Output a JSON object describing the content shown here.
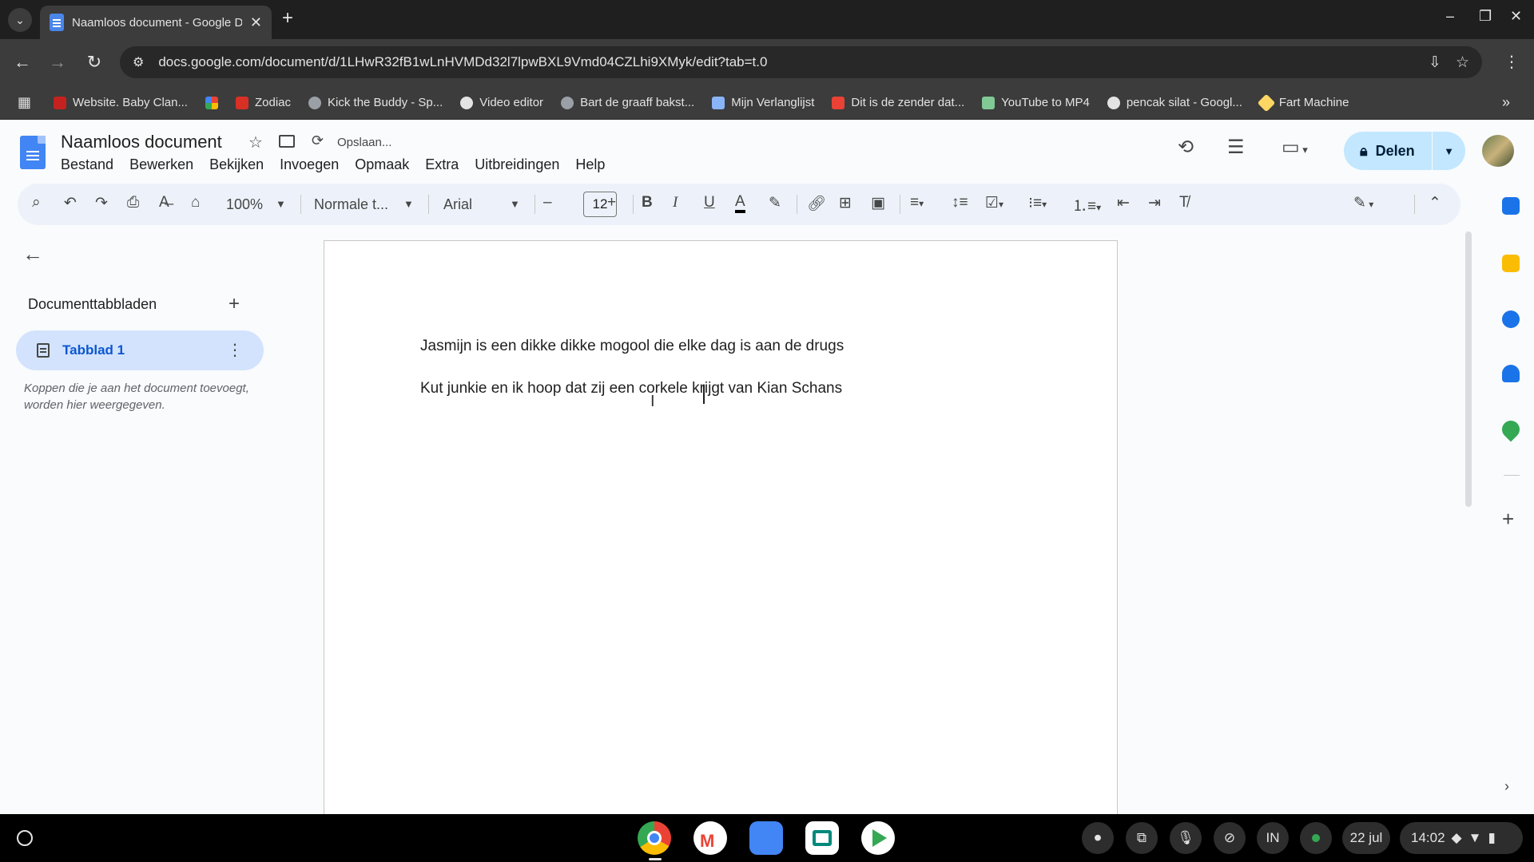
{
  "browser": {
    "tab_title": "Naamloos document - Google Docs",
    "url": "docs.google.com/document/d/1LHwR32fB1wLnHVMDd32l7lpwBXL9Vmd04CZLhi9XMyk/edit?tab=t.0",
    "bookmarks": [
      {
        "label": "Website. Baby Clan...",
        "color": "#c5221f"
      },
      {
        "label": "",
        "color": "#f4b400"
      },
      {
        "label": "Zodiac",
        "color": "#d93025"
      },
      {
        "label": "Kick the Buddy - Sp...",
        "color": "#9aa0a6"
      },
      {
        "label": "Video editor",
        "color": "#e3e3e3"
      },
      {
        "label": "Bart de graaff bakst...",
        "color": "#9aa0a6"
      },
      {
        "label": "Mijn Verlanglijst",
        "color": "#8ab4f8"
      },
      {
        "label": "Dit is de zender dat...",
        "color": "#ea4335"
      },
      {
        "label": "YouTube to MP4",
        "color": "#81c995"
      },
      {
        "label": "pencak silat - Googl...",
        "color": "#e3e3e3"
      },
      {
        "label": "Fart Machine",
        "color": "#fdd663"
      }
    ]
  },
  "docs": {
    "title": "Naamloos document",
    "saving_status": "Opslaan...",
    "menu": [
      "Bestand",
      "Bewerken",
      "Bekijken",
      "Invoegen",
      "Opmaak",
      "Extra",
      "Uitbreidingen",
      "Help"
    ],
    "share_label": "Delen"
  },
  "toolbar": {
    "zoom": "100%",
    "style": "Normale t...",
    "font": "Arial",
    "font_size": "12"
  },
  "sidebar": {
    "heading": "Documenttabbladen",
    "tab_label": "Tabblad 1",
    "hint": "Koppen die je aan het document toevoegt, worden hier weergegeven."
  },
  "document": {
    "lines": [
      "Jasmijn is een dikke dikke mogool die elke dag is aan de drugs",
      "Kut junkie en ik hoop dat zij een corkele krijgt van Kian Schans"
    ]
  },
  "side_panel_icons": [
    {
      "name": "calendar-icon",
      "color": "#1a73e8"
    },
    {
      "name": "keep-icon",
      "color": "#fbbc04"
    },
    {
      "name": "tasks-icon",
      "color": "#1a73e8"
    },
    {
      "name": "contacts-icon",
      "color": "#1a73e8"
    },
    {
      "name": "maps-icon",
      "color": "#34a853"
    }
  ],
  "shelf": {
    "ime": "IN",
    "date": "22 jul",
    "time": "14:02"
  }
}
